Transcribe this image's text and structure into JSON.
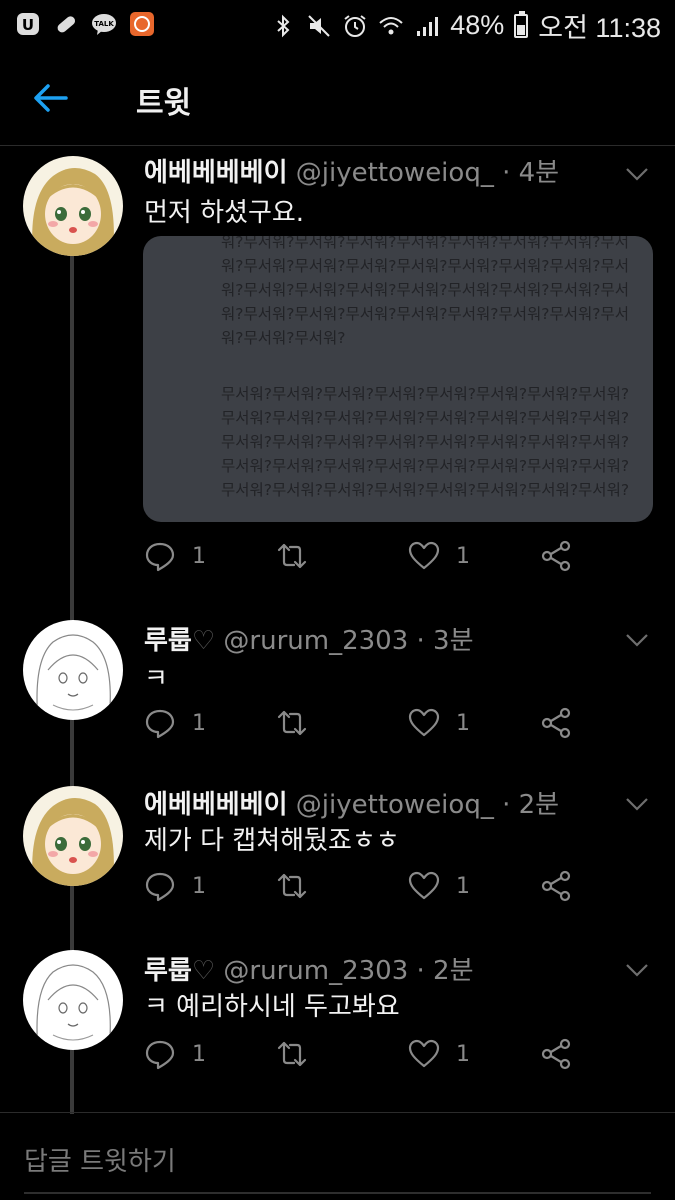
{
  "status_bar": {
    "battery": "48%",
    "time": "오전 11:38",
    "battery_level": 0.48,
    "left_icons": [
      "u-plus-icon",
      "pill-icon",
      "kakaotalk-icon",
      "app-notification-icon"
    ],
    "kakao_label": "TALK"
  },
  "header": {
    "title": "트윗"
  },
  "tweets": [
    {
      "name": "에베베베베이",
      "handle": "@jiyettoweioq_",
      "time": "· 4분",
      "text": "먼저 하셨구요.",
      "replies": "1",
      "likes": "1",
      "media_text": {
        "top": "워?무서워?무서워?무서워?무서워?무서워?무서워?무서워?무서워?무서워?무서워?무서워?무서워?무서워?무서워?무서워?무서워?무서워?무서워?무서워?무서워?무서워?무서워?무서워?무서워?무서워?무서워?무서워?무서워?무서워?무서워?무서워?무서워?무서워?무서워?",
        "bottom": "무서워?무서워?무서워?무서워?무서워?무서워?무서워?무서워?무서워?무서워?무서워?무서워?무서워?무서워?무서워?무서워?무서워?무서워?무서워?무서워?무서워?무서워?무서워?무서워?무서워?무서워?무서워?무서워?무서워?무서워?무서워?무서워?무서워?무서워?무서워?무서워?무서워?무서워?무서워?무서워?"
      }
    },
    {
      "name": "루룹",
      "handle": "@rurum_2303",
      "time": "· 3분",
      "text": "ㅋ",
      "replies": "1",
      "likes": "1"
    },
    {
      "name": "에베베베베이",
      "handle": "@jiyettoweioq_",
      "time": "· 2분",
      "text": "제가 다 캡쳐해뒀죠ㅎㅎ",
      "replies": "1",
      "likes": "1"
    },
    {
      "name": "루룹",
      "handle": "@rurum_2303",
      "time": "· 2분",
      "text": "ㅋ 예리하시네 두고봐요",
      "replies": "1",
      "likes": "1"
    }
  ],
  "reply_bar": {
    "placeholder": "답글 트윗하기"
  },
  "colors": {
    "accent": "#1da1f2",
    "background": "#000000",
    "media_bg": "#3d4046"
  }
}
